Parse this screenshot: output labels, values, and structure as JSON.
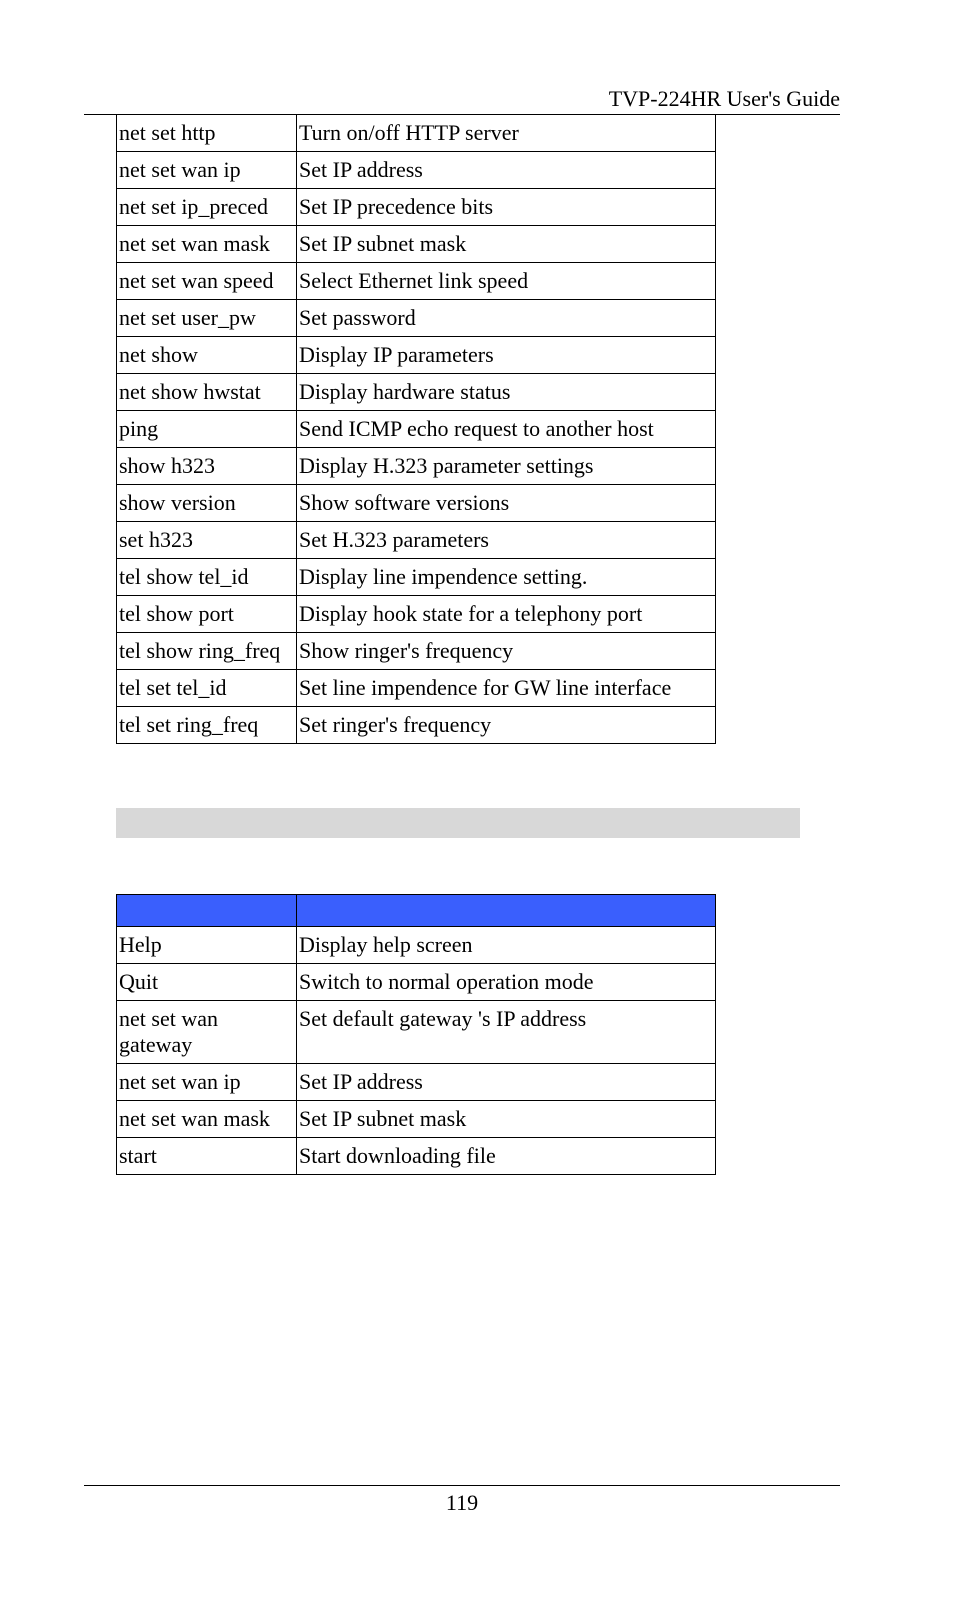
{
  "header": {
    "title": "TVP-224HR User's Guide"
  },
  "table1": {
    "rows": [
      {
        "cmd": "net set http",
        "desc": "Turn on/off HTTP server"
      },
      {
        "cmd": "net set wan ip",
        "desc": "Set IP address"
      },
      {
        "cmd": "net set ip_preced",
        "desc": "Set IP precedence bits"
      },
      {
        "cmd": "net set wan mask",
        "desc": "Set IP subnet mask"
      },
      {
        "cmd": "net set wan speed",
        "desc": "Select Ethernet link speed"
      },
      {
        "cmd": "net set user_pw",
        "desc": "Set password"
      },
      {
        "cmd": "net show",
        "desc": "Display IP parameters"
      },
      {
        "cmd": "net show hwstat",
        "desc": "Display hardware status"
      },
      {
        "cmd": "ping",
        "desc": "Send ICMP echo request to another host"
      },
      {
        "cmd": "show h323",
        "desc": "Display H.323 parameter settings"
      },
      {
        "cmd": "show version",
        "desc": "Show software versions"
      },
      {
        "cmd": "set h323",
        "desc": "Set H.323 parameters"
      },
      {
        "cmd": "tel show tel_id",
        "desc": "Display line impendence setting."
      },
      {
        "cmd": "tel show port",
        "desc": "Display hook state for a telephony port"
      },
      {
        "cmd": "tel show ring_freq",
        "desc": "Show ringer's frequency"
      },
      {
        "cmd": "tel set tel_id",
        "desc": "Set line impendence for GW line interface"
      },
      {
        "cmd": "tel set ring_freq",
        "desc": "Set ringer's frequency"
      }
    ]
  },
  "table2": {
    "header": {
      "col1": "",
      "col2": ""
    },
    "rows": [
      {
        "cmd": "Help",
        "desc": "Display help screen"
      },
      {
        "cmd": "Quit",
        "desc": "Switch to normal operation mode"
      },
      {
        "cmd": "net set wan gateway",
        "desc": "Set default gateway 's IP address"
      },
      {
        "cmd": "net set wan ip",
        "desc": "Set IP address"
      },
      {
        "cmd": "net set wan mask",
        "desc": "Set IP subnet mask"
      },
      {
        "cmd": "start",
        "desc": "Start downloading file"
      }
    ]
  },
  "footer": {
    "page_number": "119"
  }
}
